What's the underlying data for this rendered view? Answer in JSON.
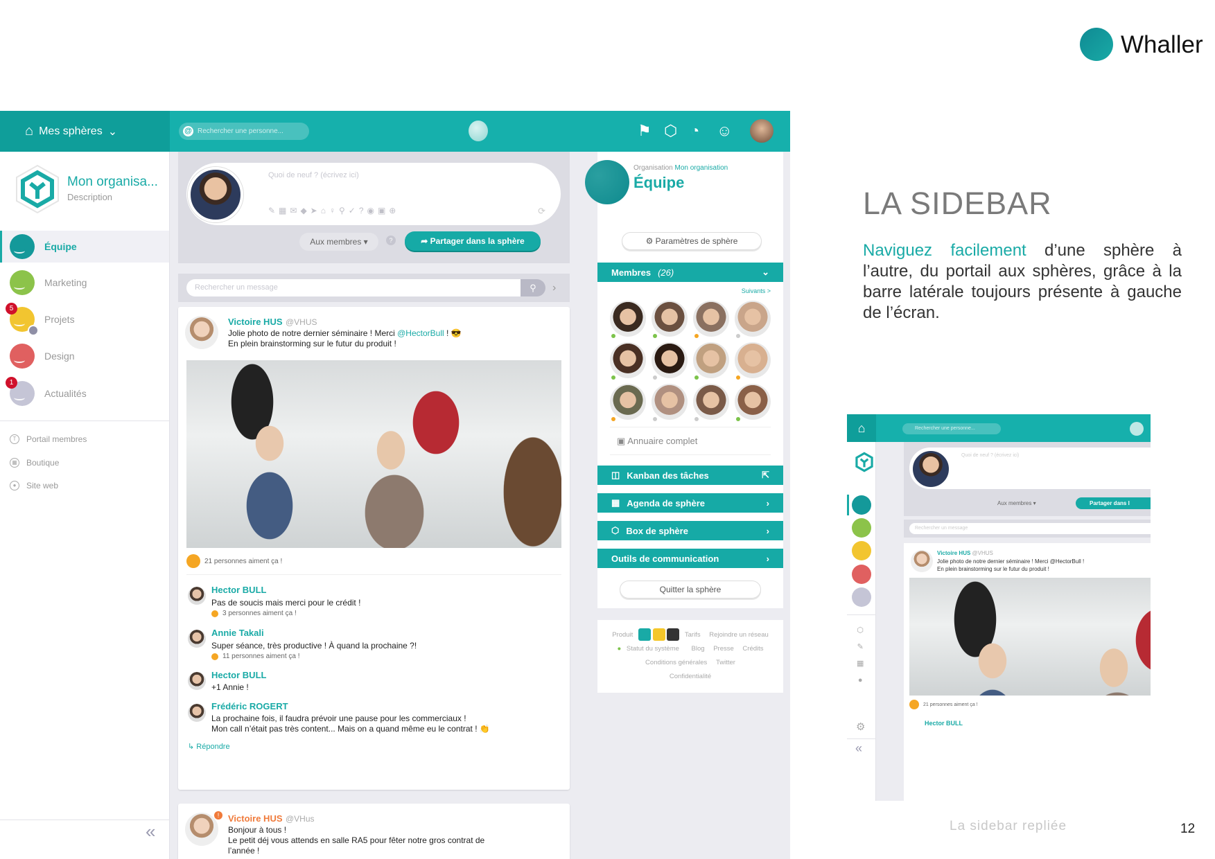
{
  "brand": {
    "name": "Whaller",
    "color": "#19aaa6"
  },
  "slide": {
    "title": "LA SIDEBAR",
    "highlight": "Naviguez facilement",
    "body": " d’une sphère à l’autre, du portail aux sphères, grâce à la barre latérale toujours présente à gauche de l’écran.",
    "caption": "La sidebar repliée",
    "page_number": "12"
  },
  "topbar": {
    "home_label": "Mes sphères",
    "search_placeholder": "Rechercher une personne...",
    "icons": [
      "flag-icon",
      "add-organization-icon",
      "add-sphere-icon",
      "add-contact-icon"
    ]
  },
  "sidebar": {
    "org_name": "Mon organisa...",
    "org_description": "Description",
    "spheres": [
      {
        "label": "Équipe",
        "color": "#14999a",
        "active": true
      },
      {
        "label": "Marketing",
        "color": "#8cc34a"
      },
      {
        "label": "Projets",
        "color": "#f2c530",
        "badge": "5"
      },
      {
        "label": "Design",
        "color": "#e06060"
      },
      {
        "label": "Actualités",
        "color": "#c5c5d6",
        "badge": "1"
      }
    ],
    "links": [
      {
        "label": "Portail membres",
        "icon": "portal-icon"
      },
      {
        "label": "Boutique",
        "icon": "shop-icon"
      },
      {
        "label": "Site web",
        "icon": "globe-icon"
      }
    ],
    "collapse": "«"
  },
  "composer": {
    "placeholder": "Quoi de neuf ? (écrivez ici)",
    "audience": "Aux membres ▾",
    "share": "Partager dans la sphère",
    "tools": "✎▦✉◆➤⌂♀⚲✓?◉▣⊕"
  },
  "message_search": {
    "placeholder": "Rechercher un message"
  },
  "post": {
    "author": "Victoire HUS",
    "handle": "@VHUS",
    "line1_pre": "Jolie photo de notre dernier séminaire ! Merci ",
    "mention": "@HectorBull",
    "line1_post": " ! 😎",
    "line2": "En plein brainstorming sur le futur du produit !",
    "likes": "21 personnes aiment ça !",
    "comments": [
      {
        "author": "Hector BULL",
        "text": "Pas de soucis mais merci pour le crédit !",
        "likes": "3 personnes aiment ça !"
      },
      {
        "author": "Annie Takali",
        "text": "Super séance, très productive ! À quand la prochaine ?!",
        "likes": "11 personnes aiment ça !"
      },
      {
        "author": "Hector BULL",
        "text": "+1 Annie !"
      },
      {
        "author": "Frédéric ROGERT",
        "text": "La prochaine fois, il faudra prévoir une pause pour les commerciaux !",
        "text2": "Mon call n’était pas très content... Mais on a quand même eu le contrat ! 👏"
      }
    ],
    "reply": "↳ Répondre"
  },
  "post2": {
    "author": "Victoire HUS",
    "handle": "@VHus",
    "line1": "Bonjour à tous !",
    "line2": "Le petit déj vous attends en salle RA5 pour fêter notre gros contrat de",
    "line3": "l’année !",
    "color": "#f07a3a"
  },
  "panel": {
    "org_label": "Organisation",
    "org_name": "Mon organisation",
    "sphere_name": "Équipe",
    "settings": "Paramètres de sphère",
    "members_label": "Membres",
    "members_count": "(26)",
    "next": "Suivants >",
    "directory": "Annuaire complet",
    "member_status": [
      "#7cc34a",
      "#7cc34a",
      "#f5a623",
      "#ccc",
      "#7cc34a",
      "#ccc",
      "#7cc34a",
      "#f5a623",
      "#f5a623",
      "#ccc",
      "#ccc",
      "#7cc34a"
    ],
    "sections": [
      {
        "label": "Kanban des tâches",
        "icon": "kanban-icon",
        "action": "⇱"
      },
      {
        "label": "Agenda de sphère",
        "icon": "calendar-icon",
        "action": "›"
      },
      {
        "label": "Box de sphère",
        "icon": "box-icon",
        "action": "›"
      },
      {
        "label": "Outils de communication",
        "action": "›"
      }
    ],
    "quit": "Quitter la sphère"
  },
  "footer": {
    "links": [
      "Produit",
      "Tarifs",
      "Rejoindre un réseau",
      "Statut du système",
      "Blog",
      "Presse",
      "Crédits",
      "Conditions générales",
      "Twitter",
      "Confidentialité"
    ]
  },
  "mini": {
    "search_placeholder": "Rechercher une personne...",
    "composer_placeholder": "Quoi de neuf ? (écrivez ici)",
    "audience": "Aux membres ▾",
    "share": "Partager dans l",
    "message_placeholder": "Rechercher un message",
    "post_author": "Victoire HUS",
    "post_handle": "@VHUS",
    "post_line1": "Jolie photo de notre dernier séminaire ! Merci @HectorBull !",
    "post_line2": "En plein brainstorming sur le futur du produit !",
    "likes": "21 personnes aiment ça !",
    "comment_author": "Hector BULL",
    "collapse": "«"
  }
}
